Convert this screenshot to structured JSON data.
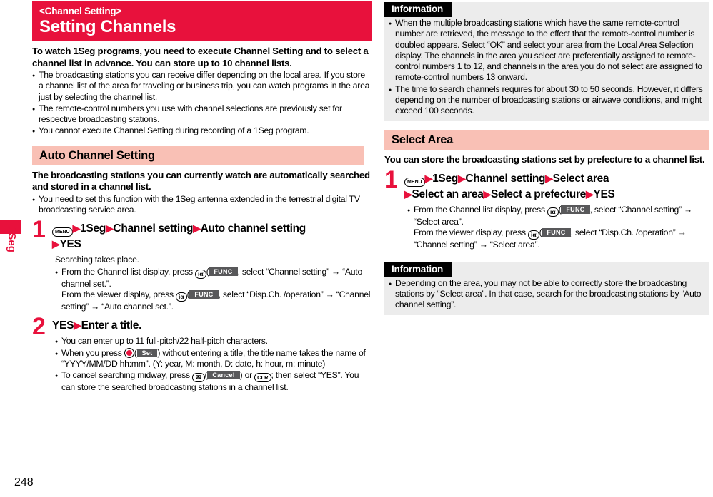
{
  "page": {
    "number": "248",
    "side_tab_label": "1Seg"
  },
  "title": {
    "kicker": "<Channel Setting>",
    "main": "Setting Channels"
  },
  "intro": {
    "lead": "To watch 1Seg programs, you need to execute Channel Setting and to select a channel list in advance. You can store up to 10 channel lists.",
    "bullets": [
      "The broadcasting stations you can receive differ depending on the local area. If you store a channel list of the area for traveling or business trip, you can watch programs in the area just by selecting the channel list.",
      "The remote-control numbers you use with channel selections are previously set for respective broadcasting stations.",
      "You cannot execute Channel Setting during recording of a 1Seg program."
    ]
  },
  "auto_channel_setting": {
    "header": "Auto Channel Setting",
    "lead": "The broadcasting stations you can currently watch are automatically searched and stored in a channel list.",
    "bullets": [
      "You need to set this function with the 1Seg antenna extended in the terrestrial digital TV broadcasting service area."
    ],
    "step1": {
      "number": "1",
      "key_menu": "MENU",
      "head_parts": [
        "1Seg",
        "Channel setting",
        "Auto channel setting"
      ],
      "head_line2": "YES",
      "note": "Searching takes place.",
      "bullet_pre": "From the Channel list display, press ",
      "key_ialpha": "iα",
      "softkey_func": "FUNC",
      "bullet_post": ", select “Channel setting” → “Auto channel set.”.",
      "bullet2_pre": "From the viewer display, press ",
      "bullet2_post": ", select “Disp.Ch. /operation” → “Channel setting” → “Auto channel set.”."
    },
    "step2": {
      "number": "2",
      "head_a": "YES",
      "head_b": "Enter a title.",
      "bullet1": "You can enter up to 11 full-pitch/22 half-pitch characters.",
      "bullet2_pre": "When you press ",
      "softkey_set": "Set",
      "bullet2_post": ") without entering a title, the title name takes the name of “YYYY/MM/DD hh:mm”. (Y: year, M: month, D: date, h: hour, m: minute)",
      "bullet3_pre": "To cancel searching midway, press ",
      "key_mail": "✉",
      "softkey_cancel": "Cancel",
      "key_clr": "CLR",
      "bullet3_post": "; then select “YES”. You can store the searched broadcasting stations in a channel list."
    }
  },
  "info_top": {
    "title": "Information",
    "bullets": [
      "When the multiple broadcasting stations which have the same remote-control number are retrieved, the message to the effect that the remote-control number is doubled appears. Select “OK” and select your area from the Local Area Selection display. The channels in the area you select are preferentially assigned to remote-control numbers 1 to 12, and channels in the area you do not select are assigned to remote-control numbers 13 onward.",
      "The time to search channels requires for about 30 to 50 seconds. However, it differs depending on the number of broadcasting stations or airwave conditions, and might exceed 100 seconds."
    ]
  },
  "select_area": {
    "header": "Select Area",
    "lead": "You can store the broadcasting stations set by prefecture to a channel list.",
    "step1": {
      "number": "1",
      "key_menu": "MENU",
      "head_parts": [
        "1Seg",
        "Channel setting",
        "Select area"
      ],
      "head_line2_parts": [
        "Select an area",
        "Select a prefecture",
        "YES"
      ],
      "bullet_pre": "From the Channel list display, press ",
      "key_ialpha": "iα",
      "softkey_func": "FUNC",
      "bullet_post": ", select “Channel setting” → “Select area”.",
      "bullet2_pre": "From the viewer display, press ",
      "bullet2_post": ", select “Disp.Ch. /operation” → “Channel setting” → “Select area”."
    }
  },
  "info_bottom": {
    "title": "Information",
    "bullets": [
      "Depending on the area, you may not be able to correctly store the broadcasting stations by “Select area”. In that case, search for the broadcasting stations by “Auto channel setting”."
    ]
  },
  "colors": {
    "brand_red": "#e8113c",
    "section_pink": "#f9c0b5",
    "info_gray": "#ececec",
    "softkey_gray": "#58585a"
  }
}
